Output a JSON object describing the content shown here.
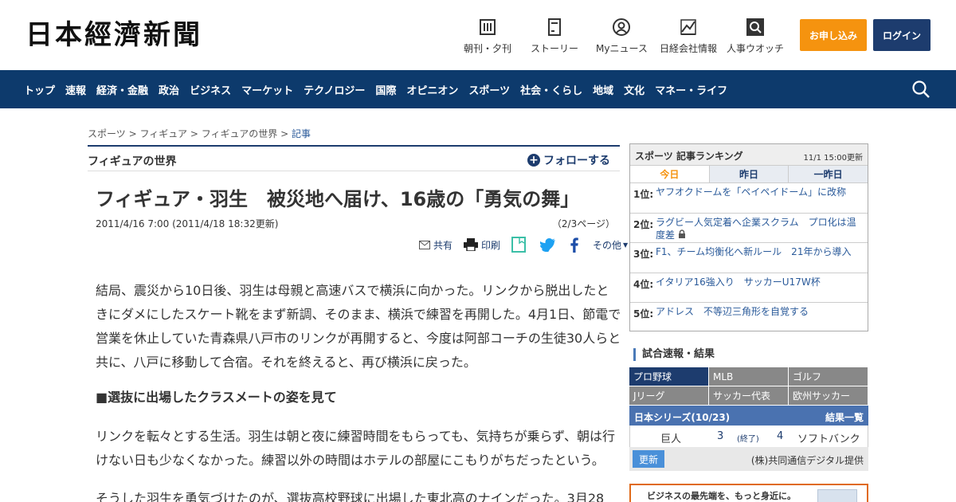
{
  "header": {
    "logo": "日本經濟新聞",
    "nav": [
      {
        "label": "朝刊・夕刊",
        "icon": "newspaper-icon"
      },
      {
        "label": "ストーリー",
        "icon": "document-icon"
      },
      {
        "label": "Myニュース",
        "icon": "user-circle-icon"
      },
      {
        "label": "日経会社情報",
        "icon": "chart-icon"
      },
      {
        "label": "人事ウオッチ",
        "icon": "search-square-icon"
      }
    ],
    "apply_label": "お申し込み",
    "login_label": "ログイン"
  },
  "navbar": {
    "items": [
      "トップ",
      "速報",
      "経済・金融",
      "政治",
      "ビジネス",
      "マーケット",
      "テクノロジー",
      "国際",
      "オピニオン",
      "スポーツ",
      "社会・くらし",
      "地域",
      "文化",
      "マネー・ライフ"
    ],
    "search_icon": "search-icon"
  },
  "breadcrumb": [
    "スポーツ",
    "フィギュア",
    "フィギュアの世界",
    "記事"
  ],
  "section": {
    "title": "フィギュアの世界",
    "follow_label": "フォローする"
  },
  "article": {
    "title": "フィギュア・羽生　被災地へ届け、16歳の「勇気の舞」",
    "date": "2011/4/16 7:00 (2011/4/18 18:32更新)",
    "pages": "（2/3ページ）",
    "share": {
      "share": "共有",
      "print": "印刷",
      "more": "その他"
    },
    "p1": "結局、震災から10日後、羽生は母親と高速バスで横浜に向かった。リンクから脱出したときにダメにしたスケート靴をまず新調、そのまま、横浜で練習を再開した。4月1日、節電で営業を休止していた青森県八戸市のリンクが再開すると、今度は阿部コーチの生徒30人らと共に、八戸に移動して合宿。それを終えると、再び横浜に戻った。",
    "h3": "■選抜に出場したクラスメートの姿を見て",
    "p2": "リンクを転々とする生活。羽生は朝と夜に練習時間をもらっても、気持ちが乗らず、朝は行けない日も少なくなかった。練習以外の時間はホテルの部屋にこもりがちだったという。",
    "p3": "そうした羽生を勇気づけたのが、選抜高校野球に出場した東北高のナインだった。3月28"
  },
  "ranking": {
    "title": "スポーツ 記事ランキング",
    "updated": "11/1 15:00更新",
    "tabs": [
      "今日",
      "昨日",
      "一昨日"
    ],
    "items": [
      {
        "rank": "1位:",
        "text": "ヤフオクドームを「ペイペイドーム」に改称"
      },
      {
        "rank": "2位:",
        "text": "ラグビー人気定着へ企業スクラム　プロ化は温度差"
      },
      {
        "rank": "3位:",
        "text": "F1、チーム均衡化へ新ルール　21年から導入"
      },
      {
        "rank": "4位:",
        "text": "イタリア16強入り　サッカーU17W杯"
      },
      {
        "rank": "5位:",
        "text": "アドレス　不等辺三角形を自覚する"
      }
    ]
  },
  "scores": {
    "title": "試合速報・結果",
    "sports": [
      "プロ野球",
      "MLB",
      "ゴルフ",
      "Jリーグ",
      "サッカー代表",
      "欧州サッカー"
    ],
    "series_title": "日本シリーズ(10/23)",
    "results_link": "結果一覧",
    "game": {
      "home": "巨人",
      "home_score": "3",
      "status": "(終了)",
      "away_score": "4",
      "away": "ソフトバンク"
    },
    "update_label": "更新",
    "source": "(株)共同通信デジタル提供"
  },
  "ad": {
    "text": "ビジネスの最先端を、もっと身近に。"
  },
  "colors": {
    "navy": "#0d3a6c",
    "orange": "#f5930f",
    "link": "#2a5a9a"
  }
}
